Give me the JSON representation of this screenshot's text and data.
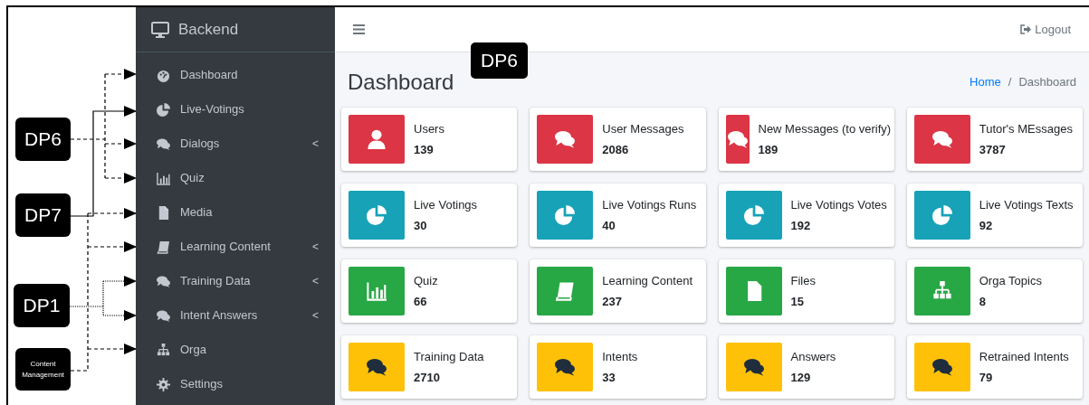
{
  "annotations": [
    {
      "label": "DP6",
      "kind": "large"
    },
    {
      "label": "DP7",
      "kind": "large"
    },
    {
      "label": "DP1",
      "kind": "large"
    },
    {
      "label": "Content Management",
      "kind": "small"
    }
  ],
  "sidebar": {
    "brand": "Backend",
    "items": [
      {
        "label": "Dashboard",
        "kind": "gauge"
      },
      {
        "label": "Live-Votings",
        "kind": "pie"
      },
      {
        "label": "Dialogs",
        "kind": "comments",
        "caret": "<"
      },
      {
        "label": "Quiz",
        "kind": "bars"
      },
      {
        "label": "Media",
        "kind": "file"
      },
      {
        "label": "Learning Content",
        "kind": "book",
        "caret": "<"
      },
      {
        "label": "Training Data",
        "kind": "comments",
        "caret": "<"
      },
      {
        "label": "Intent Answers",
        "kind": "comments",
        "caret": "<"
      },
      {
        "label": "Orga",
        "kind": "sitemap"
      },
      {
        "label": "Settings",
        "kind": "gear"
      }
    ]
  },
  "topbar": {
    "logout": "Logout"
  },
  "floating_label": "DP6",
  "page_title": "Dashboard",
  "breadcrumb": {
    "items": [
      "Home",
      "Dashboard"
    ],
    "separator": "/"
  },
  "cards": [
    {
      "label": "Users",
      "value": "139",
      "kind": "user",
      "color": "#dc3545",
      "squeezed": false
    },
    {
      "label": "User Messages",
      "value": "2086",
      "kind": "comments",
      "color": "#dc3545",
      "squeezed": false
    },
    {
      "label": "New Messages (to verify)",
      "value": "189",
      "kind": "comments",
      "color": "#dc3545",
      "squeezed": true
    },
    {
      "label": "Tutor's MEssages",
      "value": "3787",
      "kind": "comments",
      "color": "#dc3545",
      "squeezed": false
    },
    {
      "label": "Live Votings",
      "value": "30",
      "kind": "pie",
      "color": "#17a2b8",
      "squeezed": false
    },
    {
      "label": "Live Votings Runs",
      "value": "40",
      "kind": "pie",
      "color": "#17a2b8",
      "squeezed": false
    },
    {
      "label": "Live Votings Votes",
      "value": "192",
      "kind": "pie",
      "color": "#17a2b8",
      "squeezed": false
    },
    {
      "label": "Live Votings Texts",
      "value": "92",
      "kind": "pie",
      "color": "#17a2b8",
      "squeezed": false
    },
    {
      "label": "Quiz",
      "value": "66",
      "kind": "bars",
      "color": "#28a745",
      "squeezed": false
    },
    {
      "label": "Learning Content",
      "value": "237",
      "kind": "book",
      "color": "#28a745",
      "squeezed": false
    },
    {
      "label": "Files",
      "value": "15",
      "kind": "file",
      "color": "#28a745",
      "squeezed": false
    },
    {
      "label": "Orga Topics",
      "value": "8",
      "kind": "sitemap",
      "color": "#28a745",
      "squeezed": false
    },
    {
      "label": "Training Data",
      "value": "2710",
      "kind": "comments",
      "color": "#ffc107",
      "squeezed": false
    },
    {
      "label": "Intents",
      "value": "33",
      "kind": "comments",
      "color": "#ffc107",
      "squeezed": false
    },
    {
      "label": "Answers",
      "value": "129",
      "kind": "comments",
      "color": "#ffc107",
      "squeezed": false
    },
    {
      "label": "Retrained Intents",
      "value": "79",
      "kind": "comments",
      "color": "#ffc107",
      "squeezed": false
    }
  ]
}
